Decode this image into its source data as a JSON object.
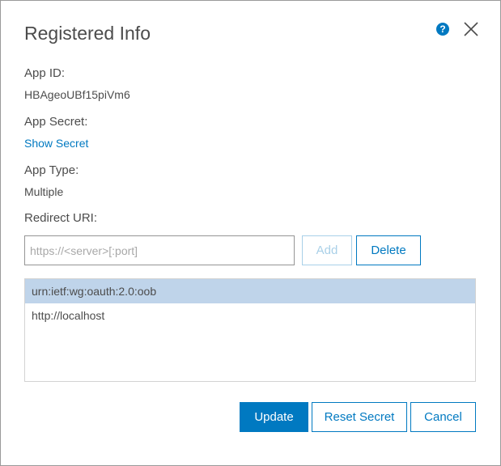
{
  "dialog": {
    "title": "Registered Info"
  },
  "fields": {
    "app_id_label": "App ID:",
    "app_id_value": "HBAgeoUBf15piVm6",
    "app_secret_label": "App Secret:",
    "show_secret_link": "Show Secret",
    "app_type_label": "App Type:",
    "app_type_value": "Multiple",
    "redirect_uri_label": "Redirect URI:"
  },
  "redirect": {
    "input_value": "",
    "placeholder": "https://<server>[:port]",
    "add_label": "Add",
    "delete_label": "Delete",
    "uris": [
      {
        "value": "urn:ietf:wg:oauth:2.0:oob",
        "selected": true
      },
      {
        "value": "http://localhost",
        "selected": false
      }
    ]
  },
  "footer": {
    "update_label": "Update",
    "reset_secret_label": "Reset Secret",
    "cancel_label": "Cancel"
  },
  "colors": {
    "accent": "#0079c1",
    "selected_row": "#bfd4ea",
    "text": "#4c4c4c"
  },
  "icons": {
    "help": "question-circle-icon",
    "close": "close-icon"
  }
}
